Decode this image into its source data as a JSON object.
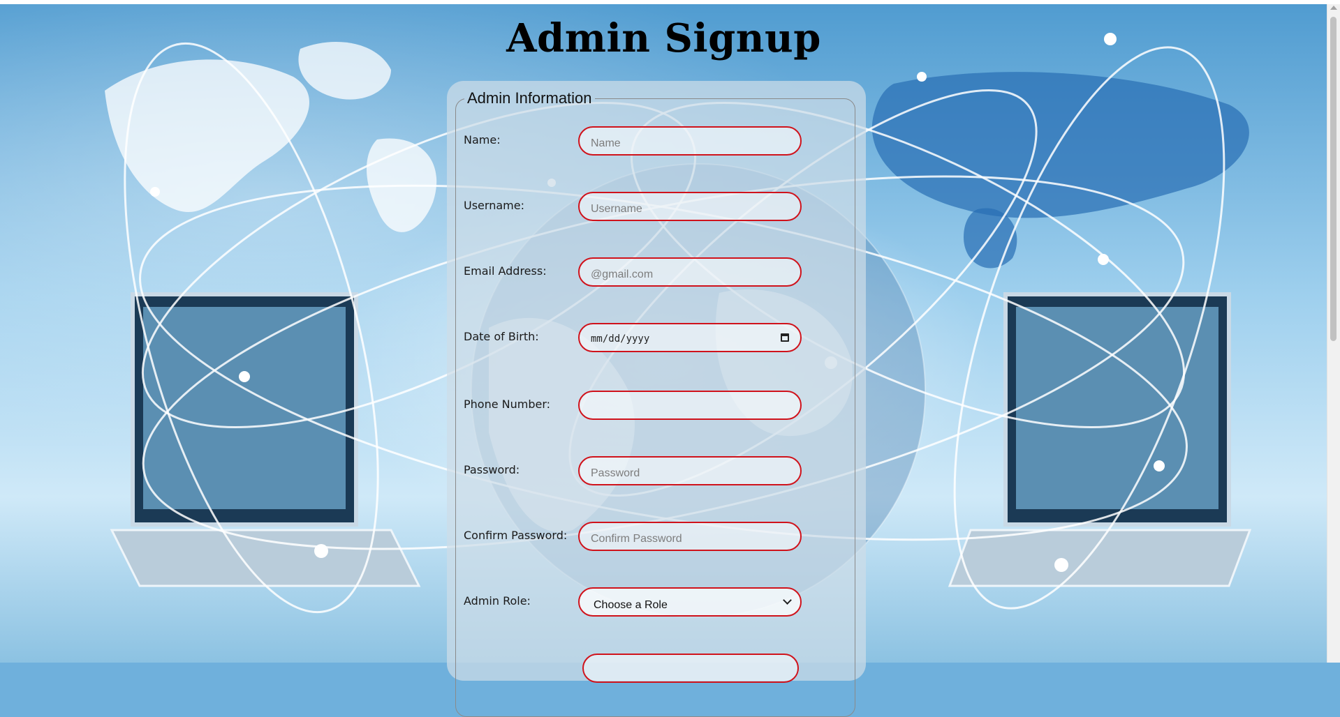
{
  "page": {
    "title": "Admin Signup"
  },
  "form": {
    "legend": "Admin Information",
    "fields": [
      {
        "label": "Name:",
        "placeholder": "Name"
      },
      {
        "label": "Username:",
        "placeholder": "Username"
      },
      {
        "label": "Email Address:",
        "placeholder": "@gmail.com"
      },
      {
        "label": "Date of Birth:",
        "placeholder": "mm/dd/yyyy"
      },
      {
        "label": "Phone Number:",
        "placeholder": ""
      },
      {
        "label": "Password:",
        "placeholder": "Password"
      },
      {
        "label": "Confirm Password:",
        "placeholder": "Confirm Password"
      },
      {
        "label": "Admin Role:",
        "selected": "Choose a Role"
      }
    ]
  },
  "colors": {
    "field_border": "#d0121b",
    "panel": "#cddce8"
  }
}
